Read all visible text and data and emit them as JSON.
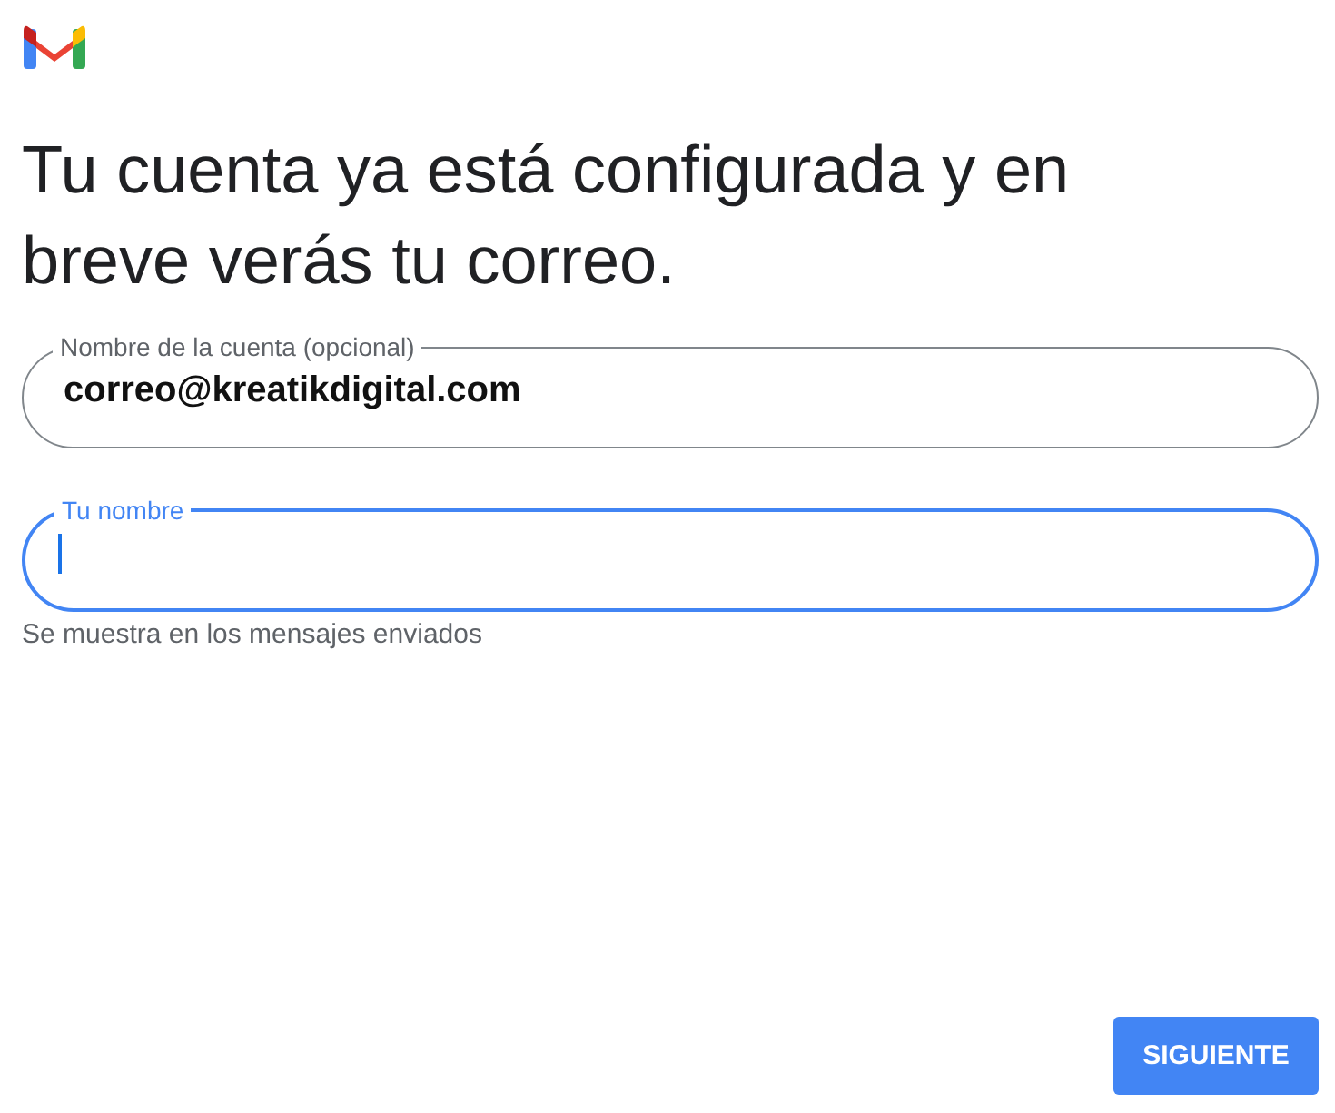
{
  "title": "Tu cuenta ya está configurada y en breve verás tu correo.",
  "fields": [
    {
      "label": "Nombre de la cuenta (opcional)",
      "value": "correo@kreatikdigital.com",
      "focused": false
    },
    {
      "label": "Tu nombre",
      "focused": true,
      "helper": "Se muestra en los mensajes enviados"
    }
  ],
  "buttons": [
    "SIGUIENTE"
  ]
}
